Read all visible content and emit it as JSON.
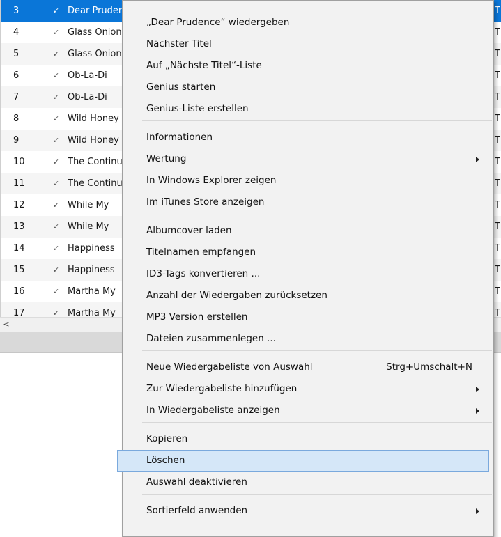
{
  "colors": {
    "selection": "#0a76d8",
    "menu_bg": "#f2f2f2",
    "hover": "#d5e7f8"
  },
  "rows": [
    {
      "num": "3",
      "title": "Dear Prudence",
      "selected": true
    },
    {
      "num": "4",
      "title": "Glass Onion"
    },
    {
      "num": "5",
      "title": "Glass Onion"
    },
    {
      "num": "6",
      "title": "Ob-La-Di"
    },
    {
      "num": "7",
      "title": "Ob-La-Di"
    },
    {
      "num": "8",
      "title": "Wild Honey"
    },
    {
      "num": "9",
      "title": "Wild Honey"
    },
    {
      "num": "10",
      "title": "The Continuing"
    },
    {
      "num": "11",
      "title": "The Continuing"
    },
    {
      "num": "12",
      "title": "While My"
    },
    {
      "num": "13",
      "title": "While My"
    },
    {
      "num": "14",
      "title": "Happiness"
    },
    {
      "num": "15",
      "title": "Happiness"
    },
    {
      "num": "16",
      "title": "Martha My"
    },
    {
      "num": "17",
      "title": "Martha My"
    }
  ],
  "row_right_char": "T",
  "check_glyph": "✓",
  "scroll_left_glyph": "<",
  "menu": {
    "items": [
      {
        "label": "„Dear Prudence“ wiedergeben"
      },
      {
        "label": "Nächster Titel"
      },
      {
        "label": "Auf „Nächste Titel“-Liste"
      },
      {
        "label": "Genius starten"
      },
      {
        "label": "Genius-Liste erstellen"
      },
      {
        "label": "Informationen"
      },
      {
        "label": "Wertung",
        "submenu": true
      },
      {
        "label": "In Windows Explorer zeigen"
      },
      {
        "label": "Im iTunes Store anzeigen"
      },
      {
        "label": "Albumcover laden"
      },
      {
        "label": "Titelnamen empfangen"
      },
      {
        "label": "ID3-Tags konvertieren ..."
      },
      {
        "label": "Anzahl der Wiedergaben zurücksetzen"
      },
      {
        "label": "MP3 Version erstellen"
      },
      {
        "label": "Dateien zusammenlegen ..."
      },
      {
        "label": "Neue Wiedergabeliste von Auswahl",
        "shortcut": "Strg+Umschalt+N"
      },
      {
        "label": "Zur Wiedergabeliste hinzufügen",
        "submenu": true
      },
      {
        "label": "In Wiedergabeliste anzeigen",
        "submenu": true
      },
      {
        "label": "Kopieren"
      },
      {
        "label": "Löschen",
        "hover": true
      },
      {
        "label": "Auswahl deaktivieren"
      },
      {
        "label": "Sortierfeld anwenden",
        "submenu": true
      }
    ]
  }
}
